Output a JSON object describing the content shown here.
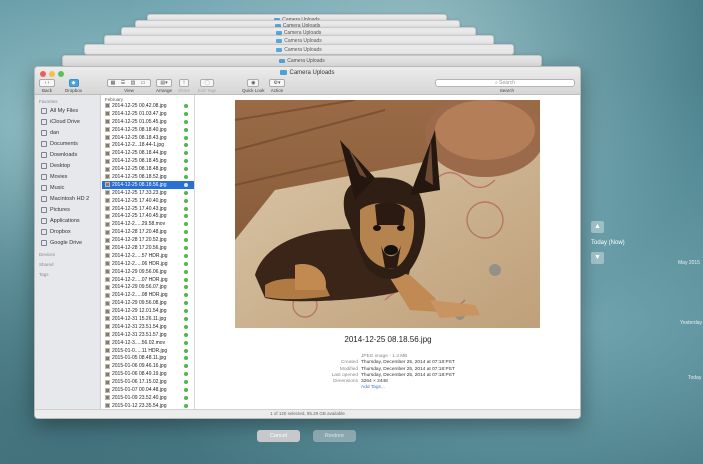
{
  "window": {
    "title": "Camera Uploads",
    "stack_title": "Camera Uploads",
    "toolbar": {
      "back": "Back",
      "dropbox": "Dropbox",
      "view": "View",
      "arrange": "Arrange",
      "share": "Share",
      "edit_tags": "Edit Tags",
      "quick_look": "Quick Look",
      "action": "Action",
      "search_placeholder": "Search",
      "search_label": "Search"
    }
  },
  "sidebar": {
    "favorites_header": "Favorites",
    "favorites": [
      {
        "label": "All My Files",
        "icon": "all-files-icon"
      },
      {
        "label": "iCloud Drive",
        "icon": "cloud-icon"
      },
      {
        "label": "dan",
        "icon": "home-icon"
      },
      {
        "label": "Documents",
        "icon": "documents-icon"
      },
      {
        "label": "Downloads",
        "icon": "downloads-icon"
      },
      {
        "label": "Desktop",
        "icon": "desktop-icon"
      },
      {
        "label": "Movies",
        "icon": "movies-icon"
      },
      {
        "label": "Music",
        "icon": "music-icon"
      },
      {
        "label": "Macintosh HD 2",
        "icon": "disk-icon"
      },
      {
        "label": "Pictures",
        "icon": "pictures-icon"
      },
      {
        "label": "Applications",
        "icon": "applications-icon"
      },
      {
        "label": "Dropbox",
        "icon": "dropbox-icon"
      },
      {
        "label": "Google Drive",
        "icon": "drive-icon"
      }
    ],
    "devices_header": "Devices",
    "shared_header": "Shared",
    "tags_header": "Tags"
  },
  "file_list": {
    "header": "February",
    "selected_index": 10,
    "files": [
      "2014-12-25 00.42.08.jpg",
      "2014-12-25 01.03.47.jpg",
      "2014-12-25 01.05.45.jpg",
      "2014-12-25 08.18.40.jpg",
      "2014-12-25 08.18.43.jpg",
      "2014-12-2...18.44-1.jpg",
      "2014-12-25 08.18.44.jpg",
      "2014-12-25 08.18.45.jpg",
      "2014-12-25 08.18.48.jpg",
      "2014-12-25 08.18.52.jpg",
      "2014-12-25 08.18.56.jpg",
      "2014-12-25 17.33.23.jpg",
      "2014-12-25 17.40.40.jpg",
      "2014-12-25 17.40.43.jpg",
      "2014-12-25 17.40.45.jpg",
      "2014-12-2.....29.58.mov",
      "2014-12-28 17.20.48.jpg",
      "2014-12-28 17.20.52.jpg",
      "2014-12-28 17.20.56.jpg",
      "2014-12-2.....57 HDR.jpg",
      "2014-12-2.....06 HDR.jpg",
      "2014-12-29 09.56.06.jpg",
      "2014-12-2.....07 HDR.jpg",
      "2014-12-29 09.56.07.jpg",
      "2014-12-2.....08 HDR.jpg",
      "2014-12-29 09.56.08.jpg",
      "2014-12-29 12.01.54.jpg",
      "2014-12-31 15.26.11.jpg",
      "2014-12-31 23.51.54.jpg",
      "2014-12-31 23.51.57.jpg",
      "2014-12-3.....56.02.mov",
      "2015-01-0.....11 HDR.jpg",
      "2015-01-05 08.48.11.jpg",
      "2015-01-06 09.46.16.jpg",
      "2015-01-06 08.49.19.jpg",
      "2015-01-06 17.15.02.jpg",
      "2015-01-07 00.04.48.jpg",
      "2015-01-09 23.52.40.jpg",
      "2015-01-12 23.35.54.jpg",
      "2015-01-20 22.05.58.jpg"
    ]
  },
  "preview": {
    "filename": "2014-12-25 08.18.56.jpg",
    "kind": "JPEG image - 1.3 MB",
    "meta": [
      {
        "key": "Created",
        "value": "Thursday, December 25, 2014 at 07:18:PST"
      },
      {
        "key": "Modified",
        "value": "Thursday, December 25, 2014 at 07:18:PST"
      },
      {
        "key": "Last opened",
        "value": "Thursday, December 25, 2014 at 07:18:PST"
      },
      {
        "key": "Dimensions",
        "value": "3264 × 2448"
      }
    ],
    "add_tags": "Add Tags..."
  },
  "status_bar": "1 of 120 selected, 85.29 GB available",
  "dialog_buttons": {
    "cancel": "Cancel",
    "restore": "Restore"
  },
  "timeline": {
    "current": "Today (Now)",
    "labels": [
      "May 2015",
      "Yesterday",
      "Today"
    ]
  }
}
